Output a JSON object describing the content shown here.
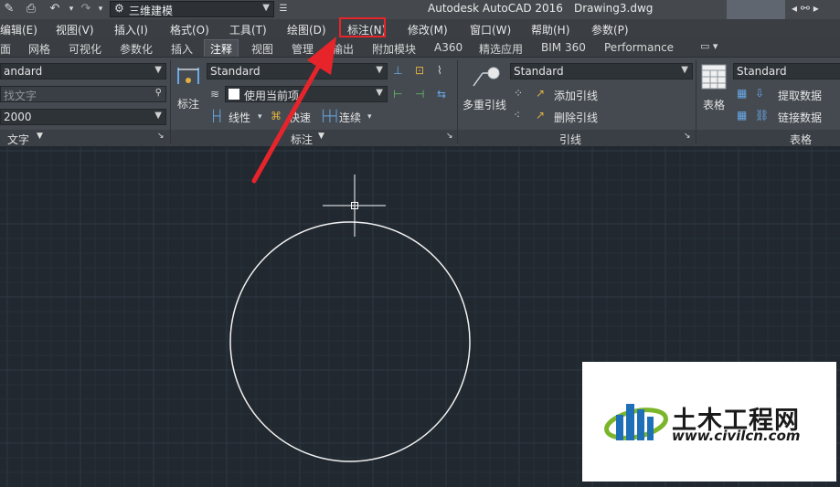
{
  "titlebar": {
    "workspace": "三维建模",
    "app_title": "Autodesk AutoCAD 2016",
    "doc_title": "Drawing3.dwg"
  },
  "menu": [
    "编辑(E)",
    "视图(V)",
    "插入(I)",
    "格式(O)",
    "工具(T)",
    "绘图(D)",
    "标注(N)",
    "修改(M)",
    "窗口(W)",
    "帮助(H)",
    "参数(P)"
  ],
  "tabs": [
    "面",
    "网格",
    "可视化",
    "参数化",
    "插入",
    "注释",
    "视图",
    "管理",
    "输出",
    "附加模块",
    "A360",
    "精选应用",
    "BIM 360",
    "Performance"
  ],
  "active_tab": "注释",
  "text_panel": {
    "style": "andard",
    "find_placeholder": "找文字",
    "height": "2000",
    "footer": "文字"
  },
  "dim_panel": {
    "big_button": "标注",
    "style": "Standard",
    "layer": "使用当前项",
    "linear": "线性",
    "quick": "快速",
    "continue": "连续",
    "footer": "标注"
  },
  "leader_panel": {
    "big_button": "多重引线",
    "style": "Standard",
    "add": "添加引线",
    "remove": "删除引线",
    "footer": "引线"
  },
  "table_panel": {
    "big_button": "表格",
    "style": "Standard",
    "extract": "提取数据",
    "link": "链接数据",
    "footer": "表格"
  },
  "watermark": {
    "name": "土木工程网",
    "url": "www.civilcn.com"
  },
  "colors": {
    "highlight": "#e8242b",
    "canvas": "#212830",
    "ribbon": "#444a50"
  }
}
